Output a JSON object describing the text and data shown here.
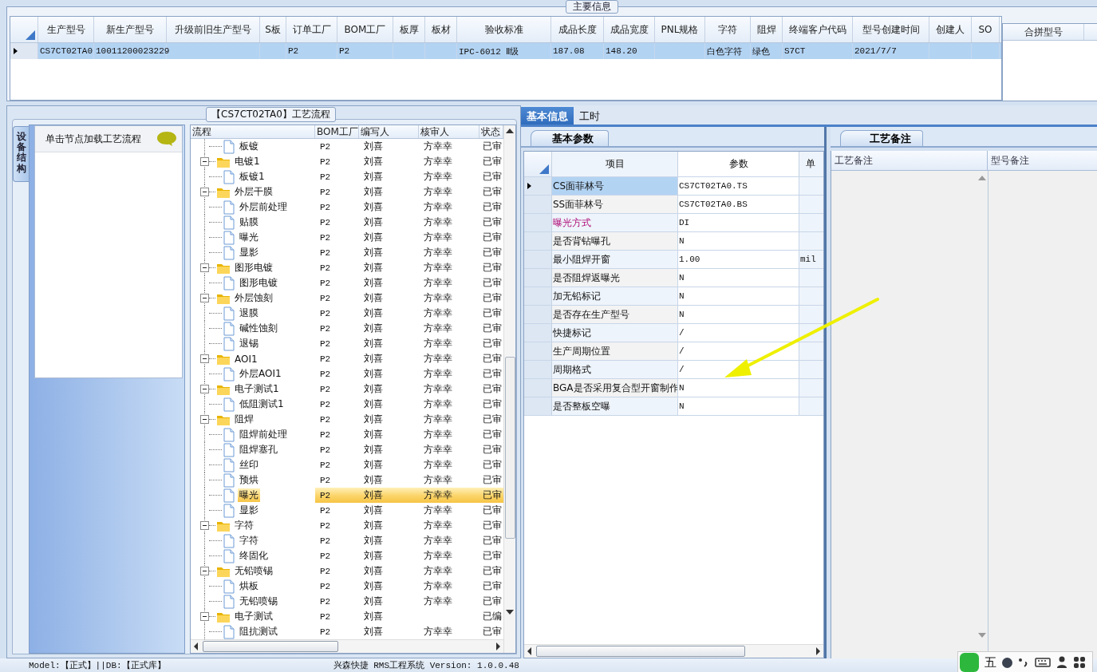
{
  "main_info": {
    "title": "主要信息",
    "columns": [
      "生产型号",
      "新生产型号",
      "升级前旧生产型号",
      "S板",
      "订单工厂",
      "BOM工厂",
      "板厚",
      "板材",
      "验收标准",
      "成品长度",
      "成品宽度",
      "PNL规格",
      "字符",
      "阻焊",
      "终端客户代码",
      "型号创建时间",
      "创建人",
      "SO"
    ],
    "rows": [
      {
        "selected": true,
        "cells": [
          "CS7CT02TA0",
          "10011200023229",
          null,
          null,
          "P2",
          "P2",
          null,
          null,
          "IPC-6012 Ⅱ级",
          "187.08",
          "148.20",
          null,
          "白色字符",
          "绿色",
          "S7CT",
          "2021/7/7",
          null,
          null
        ]
      }
    ],
    "merge_table": {
      "columns": [
        "合拼型号"
      ]
    }
  },
  "process": {
    "title": "【CS7CT02TA0】工艺流程",
    "side_tab": "设备结构",
    "hint": "单击节点加载工艺流程",
    "columns": [
      "流程",
      "BOM工厂",
      "编写人",
      "核审人",
      "状态"
    ],
    "tree": [
      {
        "kind": "file",
        "name": "板镀",
        "factory": "P2",
        "writer": "刘喜",
        "reviewer": "方幸幸",
        "status": "已审",
        "selected": false
      },
      {
        "kind": "folder",
        "name": "电镀1",
        "factory": "P2",
        "writer": "刘喜",
        "reviewer": "方幸幸",
        "status": "已审",
        "selected": false,
        "expanded": true,
        "children": [
          {
            "kind": "file",
            "name": "板镀1",
            "factory": "P2",
            "writer": "刘喜",
            "reviewer": "方幸幸",
            "status": "已审",
            "selected": false
          }
        ]
      },
      {
        "kind": "folder",
        "name": "外层干膜",
        "factory": "P2",
        "writer": "刘喜",
        "reviewer": "方幸幸",
        "status": "已审",
        "selected": false,
        "expanded": true,
        "children": [
          {
            "kind": "file",
            "name": "外层前处理",
            "factory": "P2",
            "writer": "刘喜",
            "reviewer": "方幸幸",
            "status": "已审",
            "selected": false
          },
          {
            "kind": "file",
            "name": "贴膜",
            "factory": "P2",
            "writer": "刘喜",
            "reviewer": "方幸幸",
            "status": "已审",
            "selected": false
          },
          {
            "kind": "file",
            "name": "曝光",
            "factory": "P2",
            "writer": "刘喜",
            "reviewer": "方幸幸",
            "status": "已审",
            "selected": false
          },
          {
            "kind": "file",
            "name": "显影",
            "factory": "P2",
            "writer": "刘喜",
            "reviewer": "方幸幸",
            "status": "已审",
            "selected": false
          }
        ]
      },
      {
        "kind": "folder",
        "name": "图形电镀",
        "factory": "P2",
        "writer": "刘喜",
        "reviewer": "方幸幸",
        "status": "已审",
        "selected": false,
        "expanded": true,
        "children": [
          {
            "kind": "file",
            "name": "图形电镀",
            "factory": "P2",
            "writer": "刘喜",
            "reviewer": "方幸幸",
            "status": "已审",
            "selected": false
          }
        ]
      },
      {
        "kind": "folder",
        "name": "外层蚀刻",
        "factory": "P2",
        "writer": "刘喜",
        "reviewer": "方幸幸",
        "status": "已审",
        "selected": false,
        "expanded": true,
        "children": [
          {
            "kind": "file",
            "name": "退膜",
            "factory": "P2",
            "writer": "刘喜",
            "reviewer": "方幸幸",
            "status": "已审",
            "selected": false
          },
          {
            "kind": "file",
            "name": "碱性蚀刻",
            "factory": "P2",
            "writer": "刘喜",
            "reviewer": "方幸幸",
            "status": "已审",
            "selected": false
          },
          {
            "kind": "file",
            "name": "退锡",
            "factory": "P2",
            "writer": "刘喜",
            "reviewer": "方幸幸",
            "status": "已审",
            "selected": false
          }
        ]
      },
      {
        "kind": "folder",
        "name": "AOI1",
        "factory": "P2",
        "writer": "刘喜",
        "reviewer": "方幸幸",
        "status": "已审",
        "selected": false,
        "expanded": true,
        "children": [
          {
            "kind": "file",
            "name": "外层AOI1",
            "factory": "P2",
            "writer": "刘喜",
            "reviewer": "方幸幸",
            "status": "已审",
            "selected": false
          }
        ]
      },
      {
        "kind": "folder",
        "name": "电子测试1",
        "factory": "P2",
        "writer": "刘喜",
        "reviewer": "方幸幸",
        "status": "已审",
        "selected": false,
        "expanded": true,
        "children": [
          {
            "kind": "file",
            "name": "低阻测试1",
            "factory": "P2",
            "writer": "刘喜",
            "reviewer": "方幸幸",
            "status": "已审",
            "selected": false
          }
        ]
      },
      {
        "kind": "folder",
        "name": "阻焊",
        "factory": "P2",
        "writer": "刘喜",
        "reviewer": "方幸幸",
        "status": "已审",
        "selected": false,
        "expanded": true,
        "children": [
          {
            "kind": "file",
            "name": "阻焊前处理",
            "factory": "P2",
            "writer": "刘喜",
            "reviewer": "方幸幸",
            "status": "已审",
            "selected": false
          },
          {
            "kind": "file",
            "name": "阻焊塞孔",
            "factory": "P2",
            "writer": "刘喜",
            "reviewer": "方幸幸",
            "status": "已审",
            "selected": false
          },
          {
            "kind": "file",
            "name": "丝印",
            "factory": "P2",
            "writer": "刘喜",
            "reviewer": "方幸幸",
            "status": "已审",
            "selected": false
          },
          {
            "kind": "file",
            "name": "预烘",
            "factory": "P2",
            "writer": "刘喜",
            "reviewer": "方幸幸",
            "status": "已审",
            "selected": false
          },
          {
            "kind": "file",
            "name": "曝光",
            "factory": "P2",
            "writer": "刘喜",
            "reviewer": "方幸幸",
            "status": "已审",
            "selected": true
          },
          {
            "kind": "file",
            "name": "显影",
            "factory": "P2",
            "writer": "刘喜",
            "reviewer": "方幸幸",
            "status": "已审",
            "selected": false
          }
        ]
      },
      {
        "kind": "folder",
        "name": "字符",
        "factory": "P2",
        "writer": "刘喜",
        "reviewer": "方幸幸",
        "status": "已审",
        "selected": false,
        "expanded": true,
        "children": [
          {
            "kind": "file",
            "name": "字符",
            "factory": "P2",
            "writer": "刘喜",
            "reviewer": "方幸幸",
            "status": "已审",
            "selected": false
          },
          {
            "kind": "file",
            "name": "终固化",
            "factory": "P2",
            "writer": "刘喜",
            "reviewer": "方幸幸",
            "status": "已审",
            "selected": false
          }
        ]
      },
      {
        "kind": "folder",
        "name": "无铅喷锡",
        "factory": "P2",
        "writer": "刘喜",
        "reviewer": "方幸幸",
        "status": "已审",
        "selected": false,
        "expanded": true,
        "children": [
          {
            "kind": "file",
            "name": "烘板",
            "factory": "P2",
            "writer": "刘喜",
            "reviewer": "方幸幸",
            "status": "已审",
            "selected": false
          },
          {
            "kind": "file",
            "name": "无铅喷锡",
            "factory": "P2",
            "writer": "刘喜",
            "reviewer": "方幸幸",
            "status": "已审",
            "selected": false
          }
        ]
      },
      {
        "kind": "folder",
        "name": "电子测试",
        "factory": "P2",
        "writer": "刘喜",
        "status": "已编",
        "selected": false,
        "expanded": true,
        "children": [
          {
            "kind": "file",
            "name": "阻抗测试",
            "factory": "P2",
            "writer": "刘喜",
            "reviewer": "方幸幸",
            "status": "已审",
            "selected": false
          }
        ]
      }
    ]
  },
  "detail": {
    "tabs": [
      {
        "label": "基本信息",
        "selected": true
      },
      {
        "label": "工时",
        "selected": false
      }
    ],
    "params": {
      "tab": "基本参数",
      "columns": [
        "项目",
        "参数",
        "单"
      ],
      "rows": [
        {
          "item": "CS面菲林号",
          "value": "CS7CT02TA0.TS",
          "current": true,
          "highlighted": false
        },
        {
          "item": "SS面菲林号",
          "value": "CS7CT02TA0.BS",
          "current": false,
          "highlighted": false
        },
        {
          "item": "曝光方式",
          "value": "DI",
          "current": false,
          "highlighted": true
        },
        {
          "item": "是否背钻曝孔",
          "value": "N",
          "current": false,
          "highlighted": false
        },
        {
          "item": "最小阻焊开窗",
          "value": "1.00",
          "unit": "mil",
          "current": false,
          "highlighted": false
        },
        {
          "item": "是否阻焊返曝光",
          "value": "N",
          "current": false,
          "highlighted": false
        },
        {
          "item": "加无铅标记",
          "value": "N",
          "current": false,
          "highlighted": false
        },
        {
          "item": "是否存在生产型号",
          "value": "N",
          "current": false,
          "highlighted": false
        },
        {
          "item": "快捷标记",
          "value": "/",
          "current": false,
          "highlighted": false
        },
        {
          "item": "生产周期位置",
          "value": "/",
          "current": false,
          "highlighted": false
        },
        {
          "item": "周期格式",
          "value": "/",
          "current": false,
          "highlighted": false
        },
        {
          "item": "BGA是否采用复合型开窗制作",
          "value": "N",
          "current": false,
          "highlighted": false
        },
        {
          "item": "是否整板空曝",
          "value": "N",
          "current": false,
          "highlighted": false
        }
      ]
    },
    "notes": {
      "tab": "工艺备注",
      "columns": [
        "工艺备注",
        "型号备注"
      ]
    }
  },
  "status_bar": {
    "left": "Model:【正式】||DB:【正式库】",
    "center": "兴森快捷 RMS工程系统 Version: 1.0.0.48"
  },
  "ime_toolbar": {
    "mode": "五"
  }
}
